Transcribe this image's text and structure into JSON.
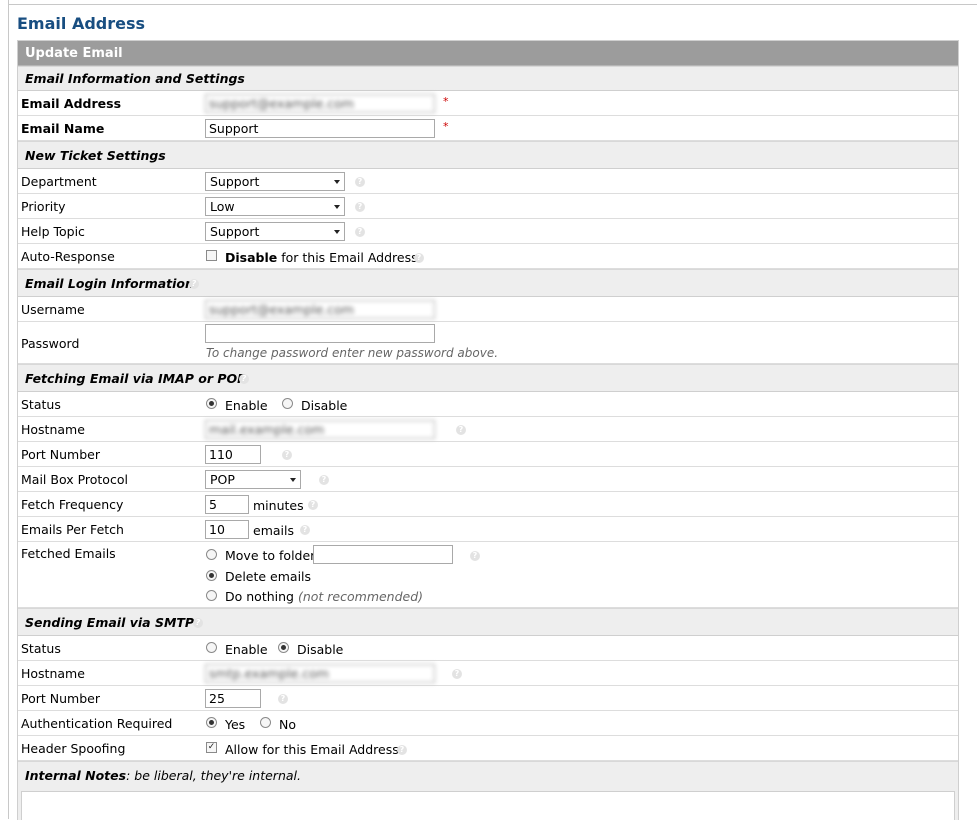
{
  "page_title": "Email Address",
  "form": {
    "header": "Update Email",
    "sections": {
      "info": "Email Information and Settings",
      "ticket": "New Ticket Settings",
      "login": "Email Login Information",
      "fetch": "Fetching Email via IMAP or POP",
      "smtp": "Sending Email via SMTP"
    },
    "email_address": {
      "label": "Email Address",
      "value": "support@example.com",
      "required": "*"
    },
    "email_name": {
      "label": "Email Name",
      "value": "Support",
      "required": "*"
    },
    "department": {
      "label": "Department",
      "value": "Support"
    },
    "priority": {
      "label": "Priority",
      "value": "Low"
    },
    "help_topic": {
      "label": "Help Topic",
      "value": "Support"
    },
    "auto_response": {
      "label": "Auto-Response",
      "checked": false,
      "text_bold": "Disable",
      "text_rest": " for this Email Address"
    },
    "username": {
      "label": "Username",
      "value": "support@example.com"
    },
    "password": {
      "label": "Password",
      "value": "",
      "note": "To change password enter new password above."
    },
    "fetch_status": {
      "label": "Status",
      "enable": "Enable",
      "disable": "Disable",
      "selected": "enable"
    },
    "fetch_hostname": {
      "label": "Hostname",
      "value": "mail.example.com"
    },
    "fetch_port": {
      "label": "Port Number",
      "value": "110"
    },
    "mailbox_protocol": {
      "label": "Mail Box Protocol",
      "value": "POP"
    },
    "fetch_frequency": {
      "label": "Fetch Frequency",
      "value": "5",
      "unit": "minutes"
    },
    "emails_per_fetch": {
      "label": "Emails Per Fetch",
      "value": "10",
      "unit": "emails"
    },
    "fetched_emails": {
      "label": "Fetched Emails",
      "move": "Move to folder:",
      "delete": "Delete emails",
      "nothing": "Do nothing",
      "nothing_note": "(not recommended)",
      "selected": "delete",
      "folder_value": ""
    },
    "smtp_status": {
      "label": "Status",
      "enable": "Enable",
      "disable": "Disable",
      "selected": "disable"
    },
    "smtp_hostname": {
      "label": "Hostname",
      "value": "smtp.example.com"
    },
    "smtp_port": {
      "label": "Port Number",
      "value": "25"
    },
    "auth_required": {
      "label": "Authentication Required",
      "yes": "Yes",
      "no": "No",
      "selected": "yes"
    },
    "header_spoofing": {
      "label": "Header Spoofing",
      "checked": true,
      "text": "Allow for this Email Address"
    },
    "internal_notes": {
      "label": "Internal Notes",
      "hint": ": be liberal, they're internal."
    }
  },
  "icons": {
    "help": "help-icon",
    "required": "required-asterisk"
  },
  "colors": {
    "title": "#184e81",
    "header_bg": "#9c9c9c",
    "section_bg": "#eeeeee",
    "required": "#cc0000"
  }
}
